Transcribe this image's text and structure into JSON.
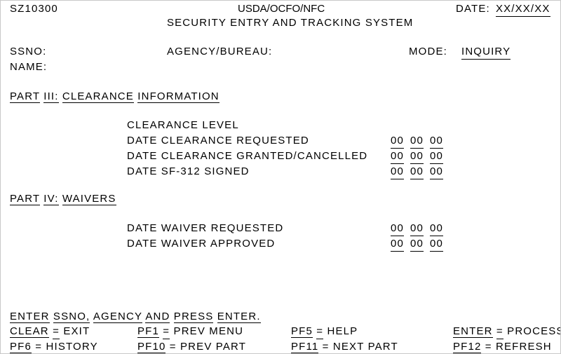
{
  "screen": {
    "screen_id": "SZ10300",
    "organization": "USDA/OCFO/NFC",
    "system_title": "SECURITY ENTRY AND TRACKING SYSTEM",
    "date_label": "DATE:",
    "date_value": "XX/XX/XX",
    "background_color": "#ffffff",
    "text_color": "#000000"
  },
  "identification": {
    "ssno_label": "SSNO:",
    "ssno_value": "",
    "name_label": "NAME:",
    "name_value": "",
    "agency_bureau_label": "AGENCY/BUREAU:",
    "agency_bureau_value": "",
    "mode_label": "MODE:",
    "mode_value": "INQUIRY"
  },
  "part_three": {
    "heading_tokens": [
      "PART",
      "III:",
      "CLEARANCE",
      "INFORMATION"
    ],
    "heading_text": "PART III: CLEARANCE INFORMATION",
    "rows": [
      {
        "label": "CLEARANCE LEVEL",
        "has_date_field": false,
        "value": ""
      },
      {
        "label": "DATE CLEARANCE REQUESTED",
        "has_date_field": true,
        "mm": "00",
        "dd": "00",
        "yy": "00"
      },
      {
        "label": "DATE CLEARANCE GRANTED/CANCELLED",
        "has_date_field": true,
        "mm": "00",
        "dd": "00",
        "yy": "00"
      },
      {
        "label": "DATE SF-312 SIGNED",
        "has_date_field": true,
        "mm": "00",
        "dd": "00",
        "yy": "00"
      }
    ]
  },
  "part_four": {
    "heading_tokens": [
      "PART",
      "IV:",
      "WAIVERS"
    ],
    "heading_text": "PART IV: WAIVERS",
    "rows": [
      {
        "label": "DATE WAIVER REQUESTED",
        "has_date_field": true,
        "mm": "00",
        "dd": "00",
        "yy": "00"
      },
      {
        "label": "DATE WAIVER APPROVED",
        "has_date_field": true,
        "mm": "00",
        "dd": "00",
        "yy": "00"
      }
    ]
  },
  "footer": {
    "instruction_tokens": [
      "ENTER",
      "SSNO,",
      "AGENCY",
      "AND",
      "PRESS",
      "ENTER."
    ],
    "instruction_text": "ENTER SSNO, AGENCY AND PRESS ENTER.",
    "keys_row1": [
      {
        "key": "CLEAR",
        "eq": "=",
        "action": "EXIT"
      },
      {
        "key": "PF1",
        "eq": "=",
        "action": "PREV MENU"
      },
      {
        "key": "PF5",
        "eq": "=",
        "action": "HELP"
      },
      {
        "key": "ENTER",
        "eq": "=",
        "action": "PROCESS"
      }
    ],
    "keys_row2": [
      {
        "key": "PF6",
        "eq": "=",
        "action": "HISTORY"
      },
      {
        "key": "PF10",
        "eq": "=",
        "action": "PREV PART"
      },
      {
        "key": "PF11",
        "eq": "=",
        "action": "NEXT PART"
      },
      {
        "key": "PF12",
        "eq": "=",
        "action": "REFRESH"
      }
    ]
  }
}
